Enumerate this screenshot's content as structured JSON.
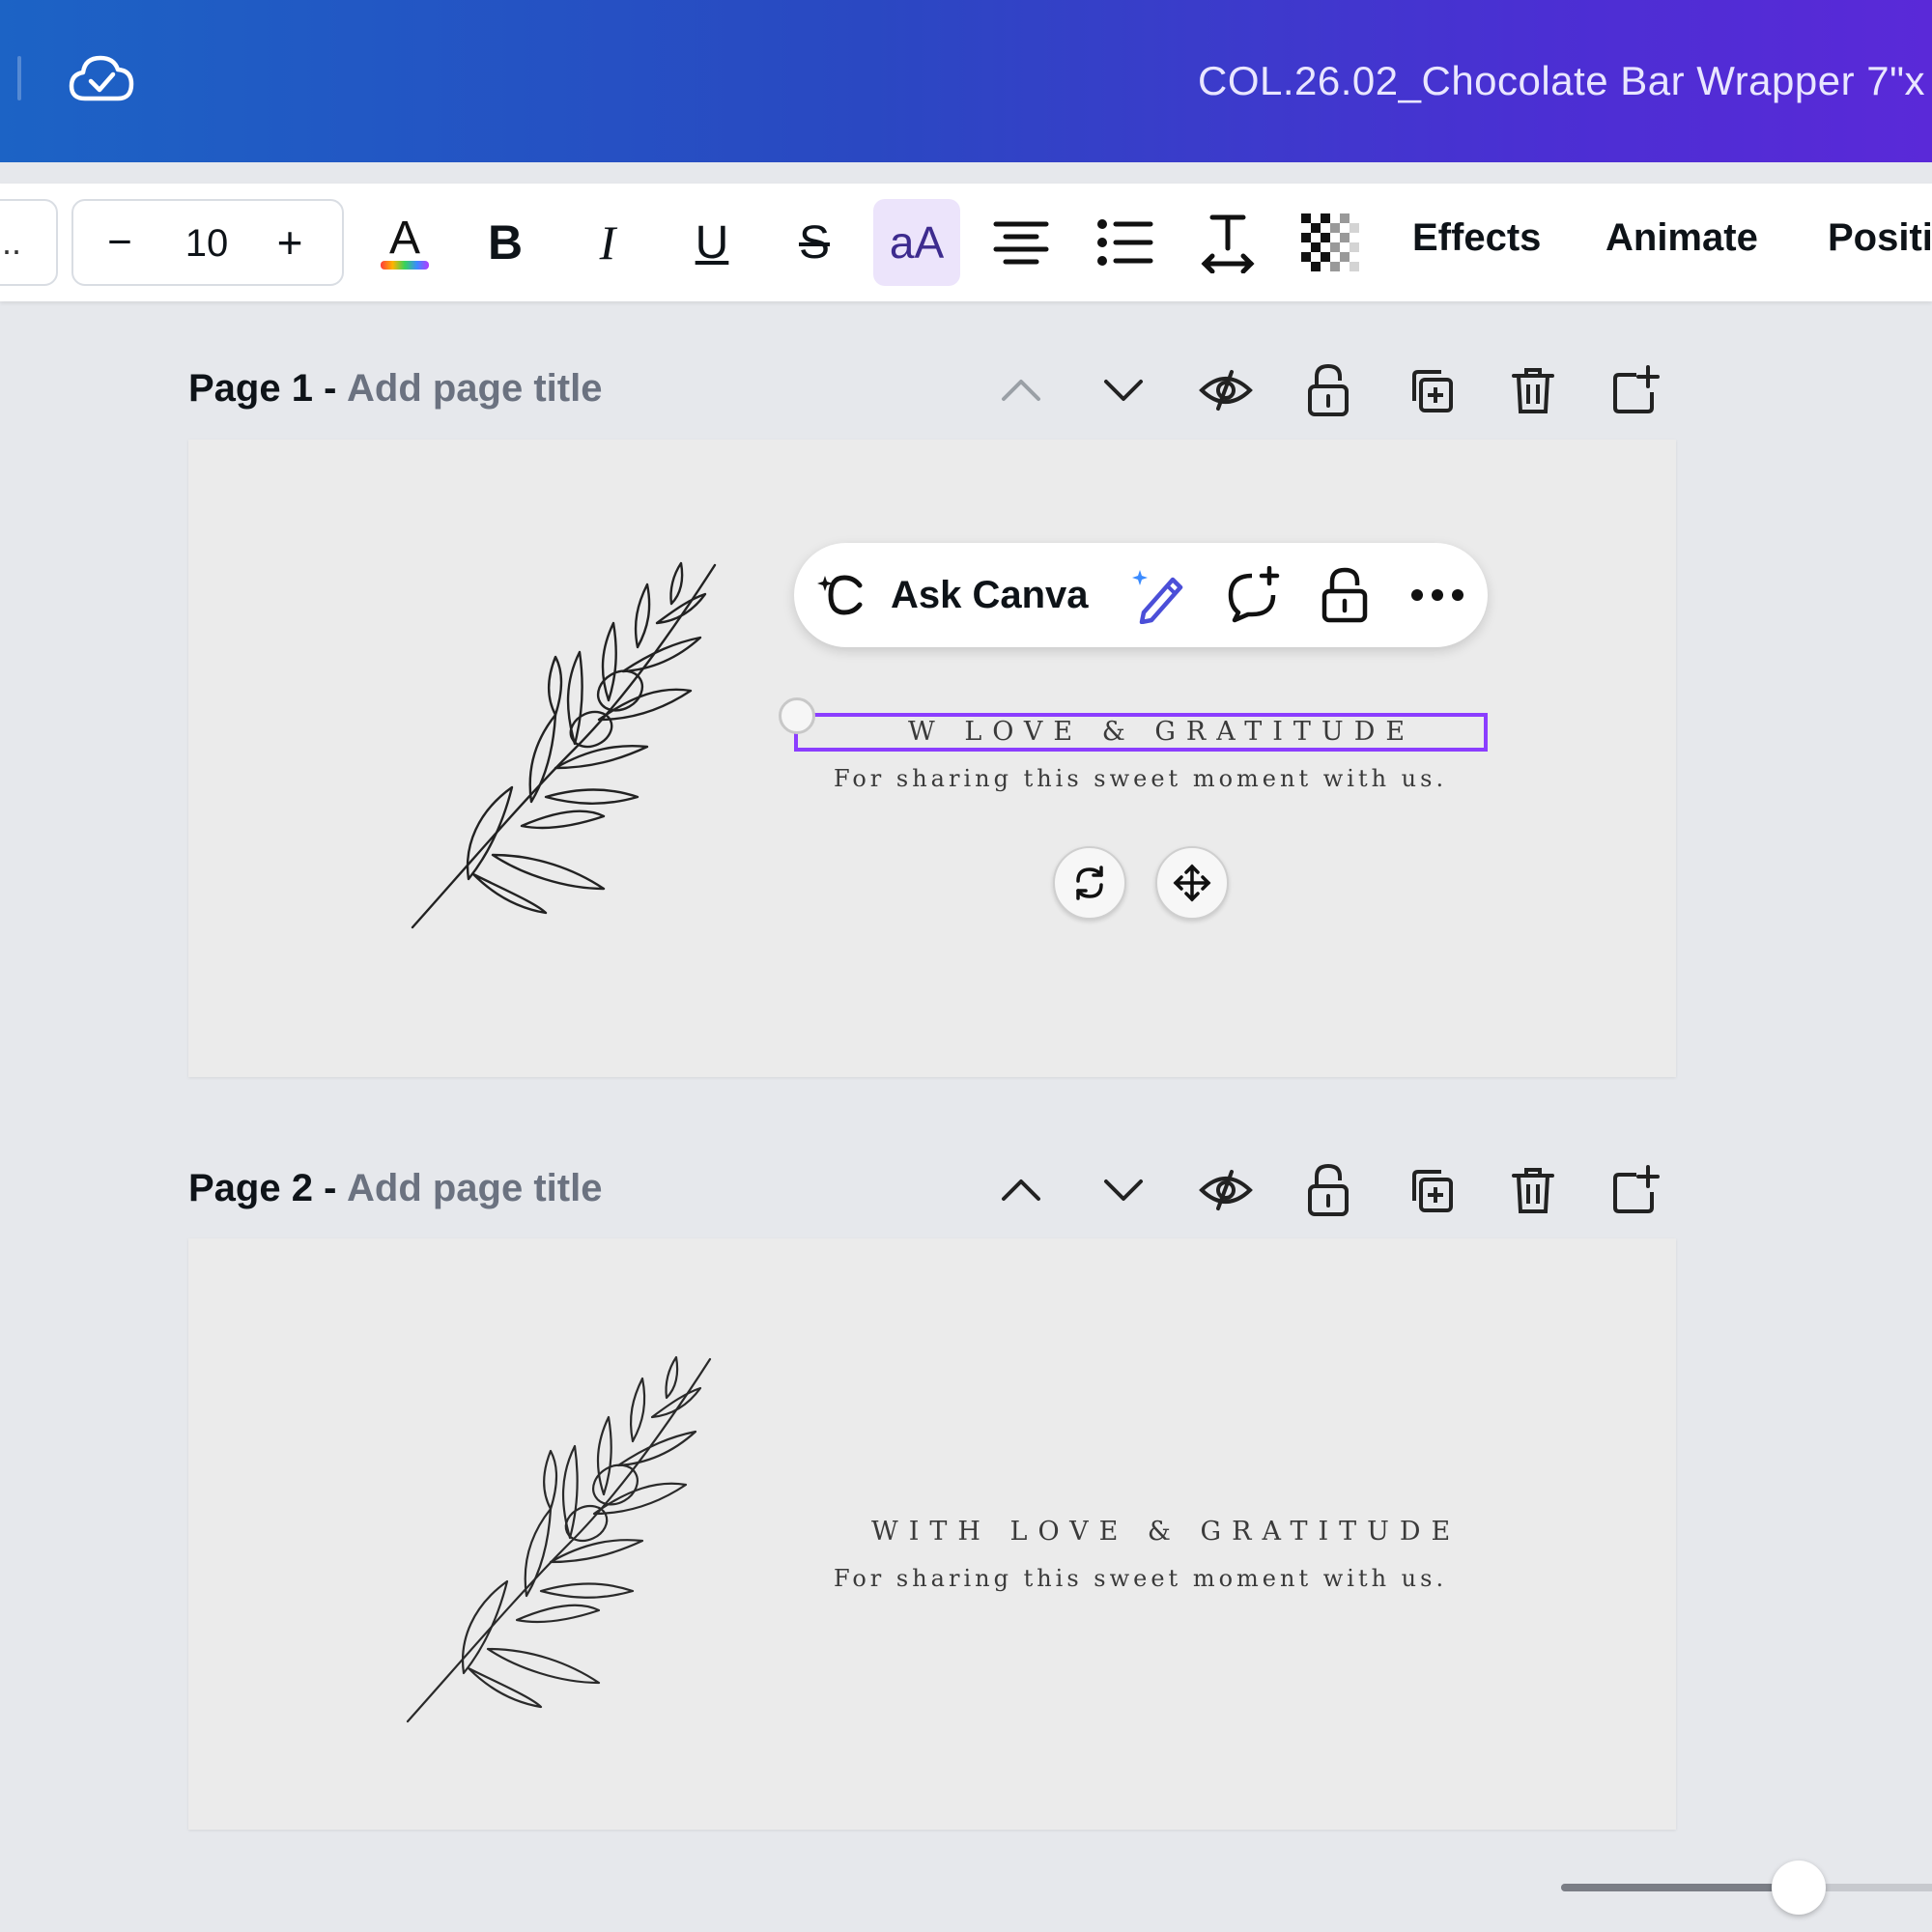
{
  "header": {
    "doc_title": "COL.26.02_Chocolate Bar Wrapper 7\"x",
    "cloud_icon": "cloud-check-icon"
  },
  "toolbar": {
    "font_stub": "..",
    "font_size": "10",
    "decrease_label": "−",
    "increase_label": "+",
    "text_color_letter": "A",
    "bold_label": "B",
    "italic_label": "I",
    "underline_label": "U",
    "strike_label": "S",
    "case_label": "aA",
    "effects_label": "Effects",
    "animate_label": "Animate",
    "position_label": "Positi",
    "accent": "#8b3dff"
  },
  "pages": [
    {
      "label": "Page 1 -",
      "title_placeholder": "Add page title",
      "headline": "W LOVE & GRATITUDE",
      "subline": "For sharing this sweet moment with us."
    },
    {
      "label": "Page 2 -",
      "title_placeholder": "Add page title",
      "headline": "WITH LOVE & GRATITUDE",
      "subline": "For sharing this sweet moment with us."
    }
  ],
  "context_menu": {
    "ask_label": "Ask Canva"
  }
}
